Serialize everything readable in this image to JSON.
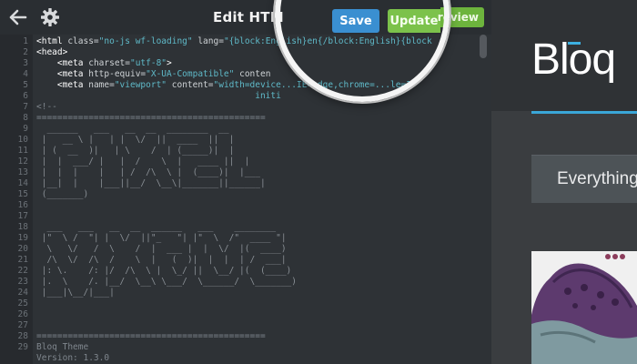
{
  "toolbar": {
    "title": "Edit HTM",
    "save_label": "Save",
    "update_label": "Update",
    "preview_label": "review",
    "back_icon": "arrow-left-icon",
    "settings_icon": "gear-icon"
  },
  "editor": {
    "line_numbers": [
      "1",
      "2",
      "3",
      "4",
      "5",
      "6",
      "7",
      "8",
      "9",
      "10",
      "11",
      "12",
      "13",
      "14",
      "15",
      "16",
      "17",
      "18",
      "19",
      "20",
      "21",
      "22",
      "23",
      "24",
      "25",
      "26",
      "27",
      "28",
      "29"
    ],
    "code_lines": [
      {
        "tag": "<html ",
        "attr": "class=",
        "str": "\"no-js wf-loading\"",
        "rest": " lang=",
        "str2": "\"{block:English}en{/block:English}{block"
      },
      {
        "tag": "<head>"
      },
      {
        "indent": "    ",
        "tag": "<meta ",
        "attr": "charset=",
        "str": "\"utf-8\"",
        "close": ">"
      },
      {
        "indent": "    ",
        "tag": "<meta ",
        "attr": "http-equiv=",
        "str": "\"X-UA-Compatible\"",
        "rest": " conten"
      },
      {
        "indent": "    ",
        "tag": "<meta ",
        "attr": "name=",
        "str": "\"viewport\"",
        "rest": " content=",
        "str2": "\"width=device...IE=edge,chrome=...le=1\""
      },
      {
        "text": "                                          initi"
      },
      {
        "comment": "<!--"
      },
      {
        "comment": "============================================"
      }
    ],
    "ascii_line_9": "  ______   ___   __  __  ________  __",
    "ascii_art_1": [
      " |   __ \\ |   | |  \\/  ||  ____  ||  |",
      " | (  __  )|   | \\    /  | (_____)|  |",
      " |  |  ___/ |   |  /    \\  |   ____ ||  |",
      " |  |  |    |   | /  /\\  \\ |  (____)|  |___",
      " |__|  |    |___||__/  \\__\\|_______||______|",
      " (_______)                       "
    ],
    "ascii_art_2": [
      "  ___   ___   __  __  ______   ___    ________",
      " |\"  \\ /  \"| |  \\/  ||\"_   \"| |\"  \\  /\"  ____ \"|",
      "  \\   \\/   /  \\    /  |  ___ |  |  \\/  |(  ____)",
      "  /\\  \\/  /\\  /    \\  |   (  )|  |  |  | /  ___|",
      " |: \\.    /: |/  /\\  \\ |  \\_/ ||  \\__/ |(  (____)",
      " |.  \\    /. |__/  \\__\\ \\___/  \\______/  \\_______)",
      " |___|\\__/|___|                                 "
    ],
    "footer_lines": [
      "============================================",
      "Bloq Theme",
      "Version: 1.3.0"
    ]
  },
  "preview": {
    "logo_text": "Bloq",
    "banner_text": "Everything"
  },
  "colors": {
    "save": "#3a8fd1",
    "update": "#7cc24b",
    "accent_line": "#3aa7d8"
  }
}
